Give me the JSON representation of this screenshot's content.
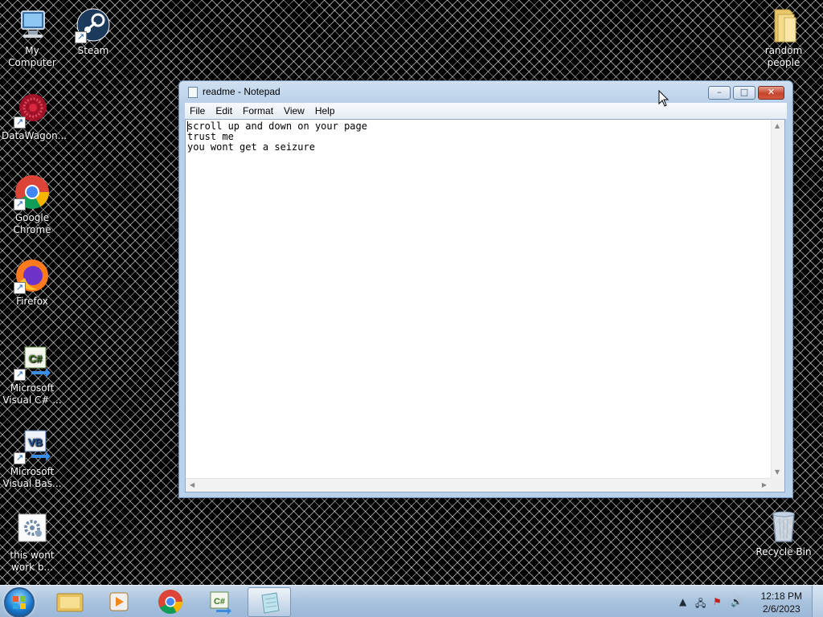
{
  "desktop": {
    "icons": [
      {
        "label": "My Computer",
        "icon": "computer-icon"
      },
      {
        "label": "Steam",
        "icon": "steam-icon"
      },
      {
        "label": "random people",
        "icon": "folder-icon"
      },
      {
        "label": "DataWagon...",
        "icon": "datawagon-icon"
      },
      {
        "label": "Google Chrome",
        "icon": "chrome-icon"
      },
      {
        "label": "Firefox",
        "icon": "firefox-icon"
      },
      {
        "label": "Microsoft Visual C# ...",
        "icon": "visual-csharp-icon"
      },
      {
        "label": "Microsoft Visual Bas...",
        "icon": "visual-basic-icon"
      },
      {
        "label": "this wont work b...",
        "icon": "settings-file-icon"
      },
      {
        "label": "Recycle Bin",
        "icon": "recycle-bin-icon"
      }
    ]
  },
  "notepad": {
    "title": "readme - Notepad",
    "menu": [
      "File",
      "Edit",
      "Format",
      "View",
      "Help"
    ],
    "lines": [
      "scroll up and down on your page",
      "trust me",
      "you wont get a seizure"
    ],
    "buttons": {
      "minimize": "–",
      "maximize": "□",
      "close": "✕"
    }
  },
  "taskbar": {
    "apps": [
      {
        "name": "Windows Explorer",
        "icon": "explorer-icon"
      },
      {
        "name": "Media Player",
        "icon": "media-player-icon"
      },
      {
        "name": "Google Chrome",
        "icon": "chrome-icon"
      },
      {
        "name": "Visual C#",
        "icon": "visual-csharp-icon"
      },
      {
        "name": "Notepad",
        "icon": "notepad-icon",
        "active": true
      }
    ],
    "time": "12:18 PM",
    "date": "2/6/2023"
  },
  "colors": {
    "titlebar": "#b9d1ea",
    "close_button": "#c6452c",
    "taskbar": "#a9c3de"
  }
}
